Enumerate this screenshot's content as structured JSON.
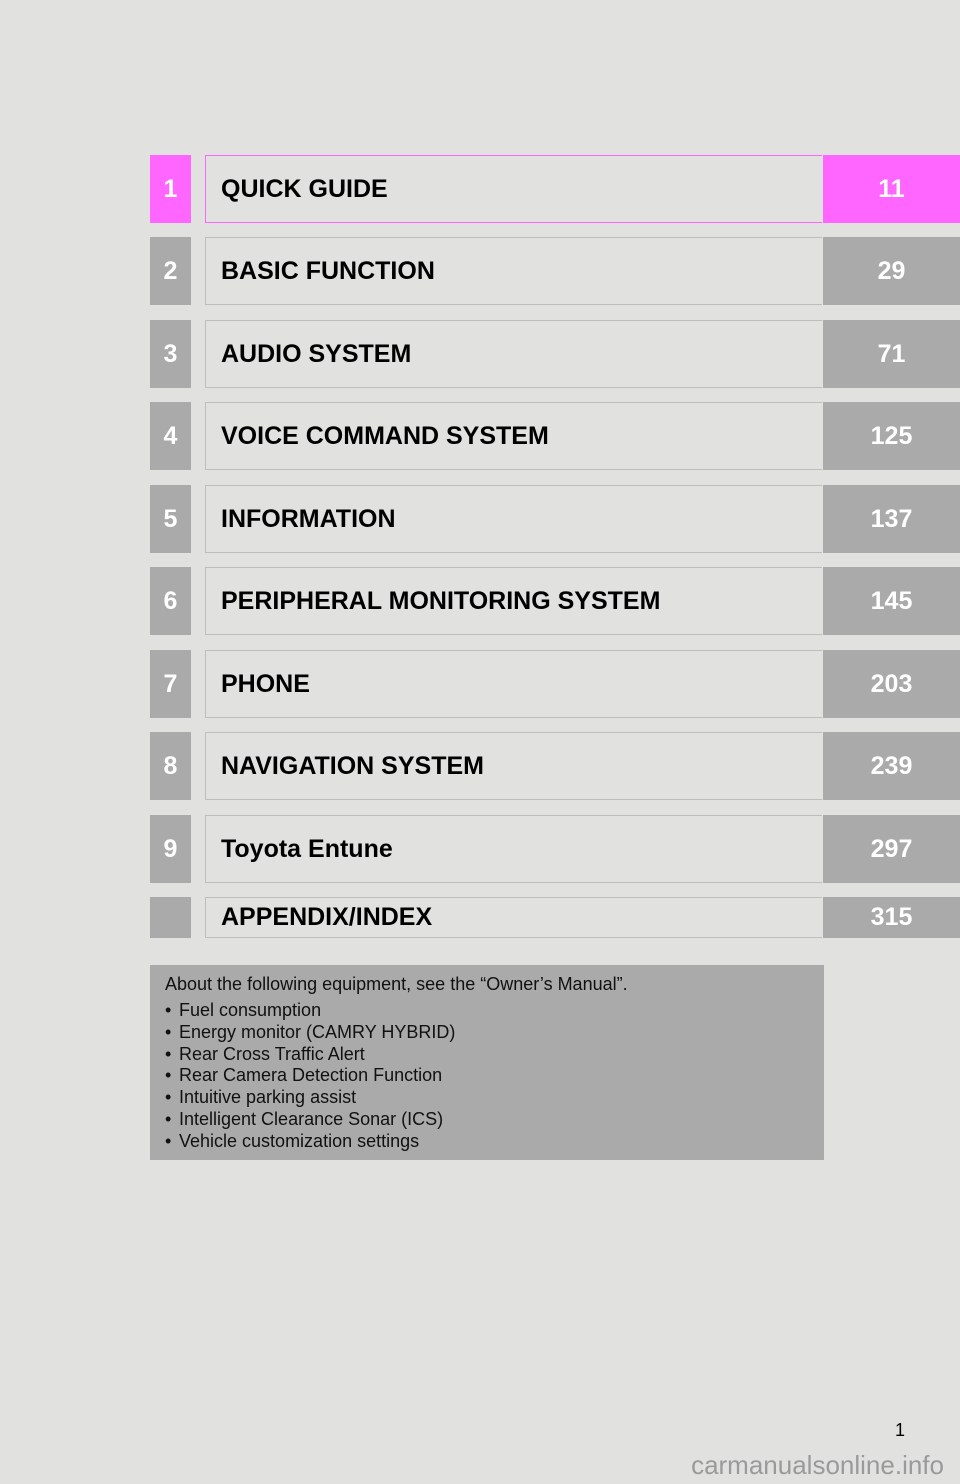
{
  "toc": {
    "entries": [
      {
        "tab": "1",
        "title": "QUICK GUIDE",
        "page": "11"
      },
      {
        "tab": "2",
        "title": "BASIC FUNCTION",
        "page": "29"
      },
      {
        "tab": "3",
        "title": "AUDIO SYSTEM",
        "page": "71"
      },
      {
        "tab": "4",
        "title": "VOICE COMMAND SYSTEM",
        "page": "125"
      },
      {
        "tab": "5",
        "title": "INFORMATION",
        "page": "137"
      },
      {
        "tab": "6",
        "title": "PERIPHERAL MONITORING SYSTEM",
        "page": "145"
      },
      {
        "tab": "7",
        "title": "PHONE",
        "page": "203"
      },
      {
        "tab": "8",
        "title": "NAVIGATION SYSTEM",
        "page": "239"
      },
      {
        "tab": "9",
        "title": "Toyota Entune",
        "page": "297"
      }
    ],
    "appendix": {
      "title": "APPENDIX/INDEX",
      "page": "315"
    },
    "active_color": "#ff66ff",
    "inactive_color": "#aaaaaa"
  },
  "info": {
    "intro": "About the following equipment, see the “Owner’s Manual”.",
    "bullet": "•",
    "items": [
      "Fuel consumption",
      "Energy monitor (CAMRY HYBRID)",
      "Rear Cross Traffic Alert",
      "Rear Camera Detection Function",
      "Intuitive parking assist",
      "Intelligent Clearance Sonar (ICS)",
      "Vehicle customization settings"
    ]
  },
  "footer": {
    "page_number": "1",
    "watermark": "carmanualsonline.info"
  }
}
